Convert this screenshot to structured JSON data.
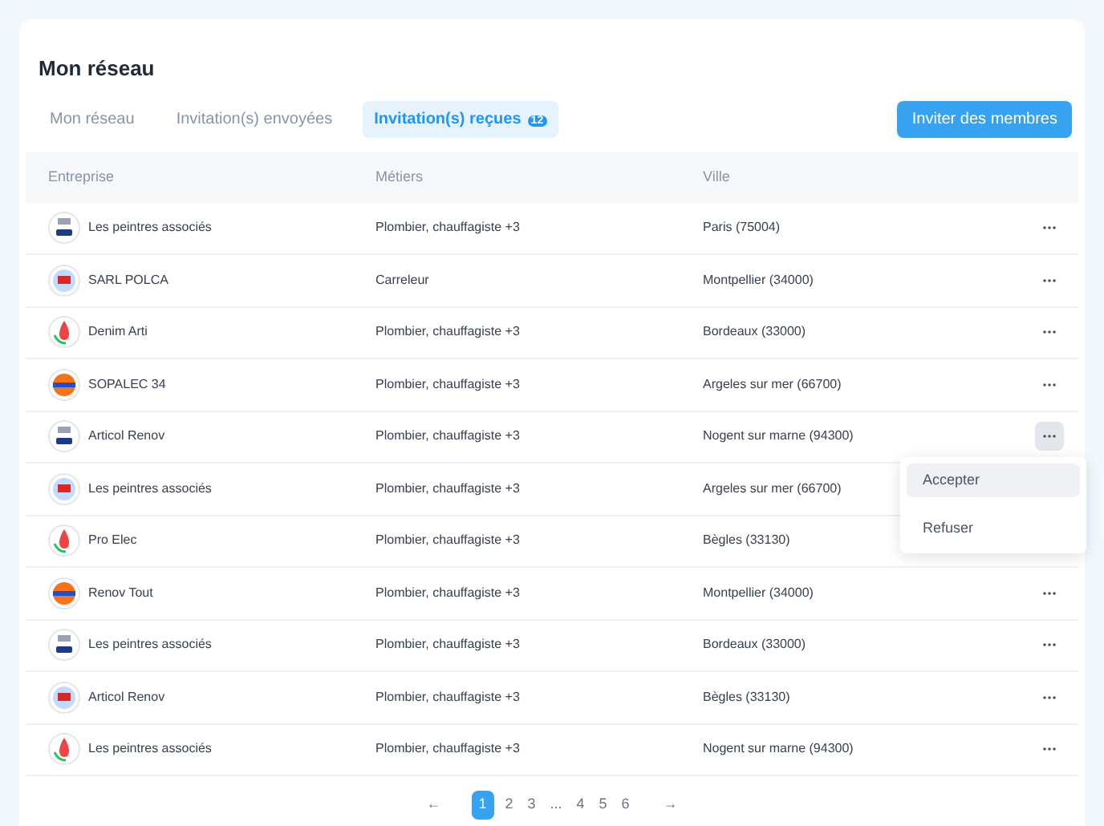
{
  "title": "Mon réseau",
  "tabs": [
    {
      "label": "Mon réseau",
      "selected": false
    },
    {
      "label": "Invitation(s) envoyées",
      "selected": false
    },
    {
      "label": "Invitation(s) reçues",
      "badge": "12",
      "selected": true
    }
  ],
  "invite_button": "Inviter des membres",
  "table": {
    "columns": [
      "Entreprise",
      "Métiers",
      "Ville"
    ],
    "rows": [
      {
        "company": "Les peintres associés",
        "trades": "Plombier, chauffagiste +3",
        "city": "Paris (75004)",
        "menu_open": false
      },
      {
        "company": "SARL POLCA",
        "trades": "Carreleur",
        "city": "Montpellier (34000)",
        "menu_open": false
      },
      {
        "company": "Denim Arti",
        "trades": "Plombier, chauffagiste +3",
        "city": "Bordeaux (33000)",
        "menu_open": false
      },
      {
        "company": "SOPALEC 34",
        "trades": "Plombier, chauffagiste +3",
        "city": "Argeles sur mer (66700)",
        "menu_open": false
      },
      {
        "company": "Articol Renov",
        "trades": "Plombier, chauffagiste +3",
        "city": "Nogent sur marne (94300)",
        "menu_open": true
      },
      {
        "company": "Les peintres associés",
        "trades": "Plombier, chauffagiste +3",
        "city": "Argeles sur mer (66700)",
        "menu_open": false
      },
      {
        "company": "Pro Elec",
        "trades": "Plombier, chauffagiste +3",
        "city": "Bègles (33130)",
        "menu_open": false
      },
      {
        "company": "Renov Tout",
        "trades": "Plombier, chauffagiste +3",
        "city": "Montpellier (34000)",
        "menu_open": false
      },
      {
        "company": "Les peintres associés",
        "trades": "Plombier, chauffagiste +3",
        "city": "Bordeaux (33000)",
        "menu_open": false
      },
      {
        "company": "Articol Renov",
        "trades": "Plombier, chauffagiste +3",
        "city": "Bègles (33130)",
        "menu_open": false
      },
      {
        "company": "Les peintres associés",
        "trades": "Plombier, chauffagiste +3",
        "city": "Nogent sur marne (94300)",
        "menu_open": false
      }
    ]
  },
  "row_menu": [
    {
      "label": "Accepter",
      "selected": true
    },
    {
      "label": "Refuser",
      "selected": false
    }
  ],
  "pagination": {
    "prev": "←",
    "next": "→",
    "pages": [
      {
        "label": "1",
        "selected": true
      },
      {
        "label": "2",
        "selected": false
      },
      {
        "label": "3",
        "selected": false
      },
      {
        "label": "...",
        "selected": false
      },
      {
        "label": "4",
        "selected": false
      },
      {
        "label": "5",
        "selected": false
      },
      {
        "label": "6",
        "selected": false
      }
    ]
  }
}
